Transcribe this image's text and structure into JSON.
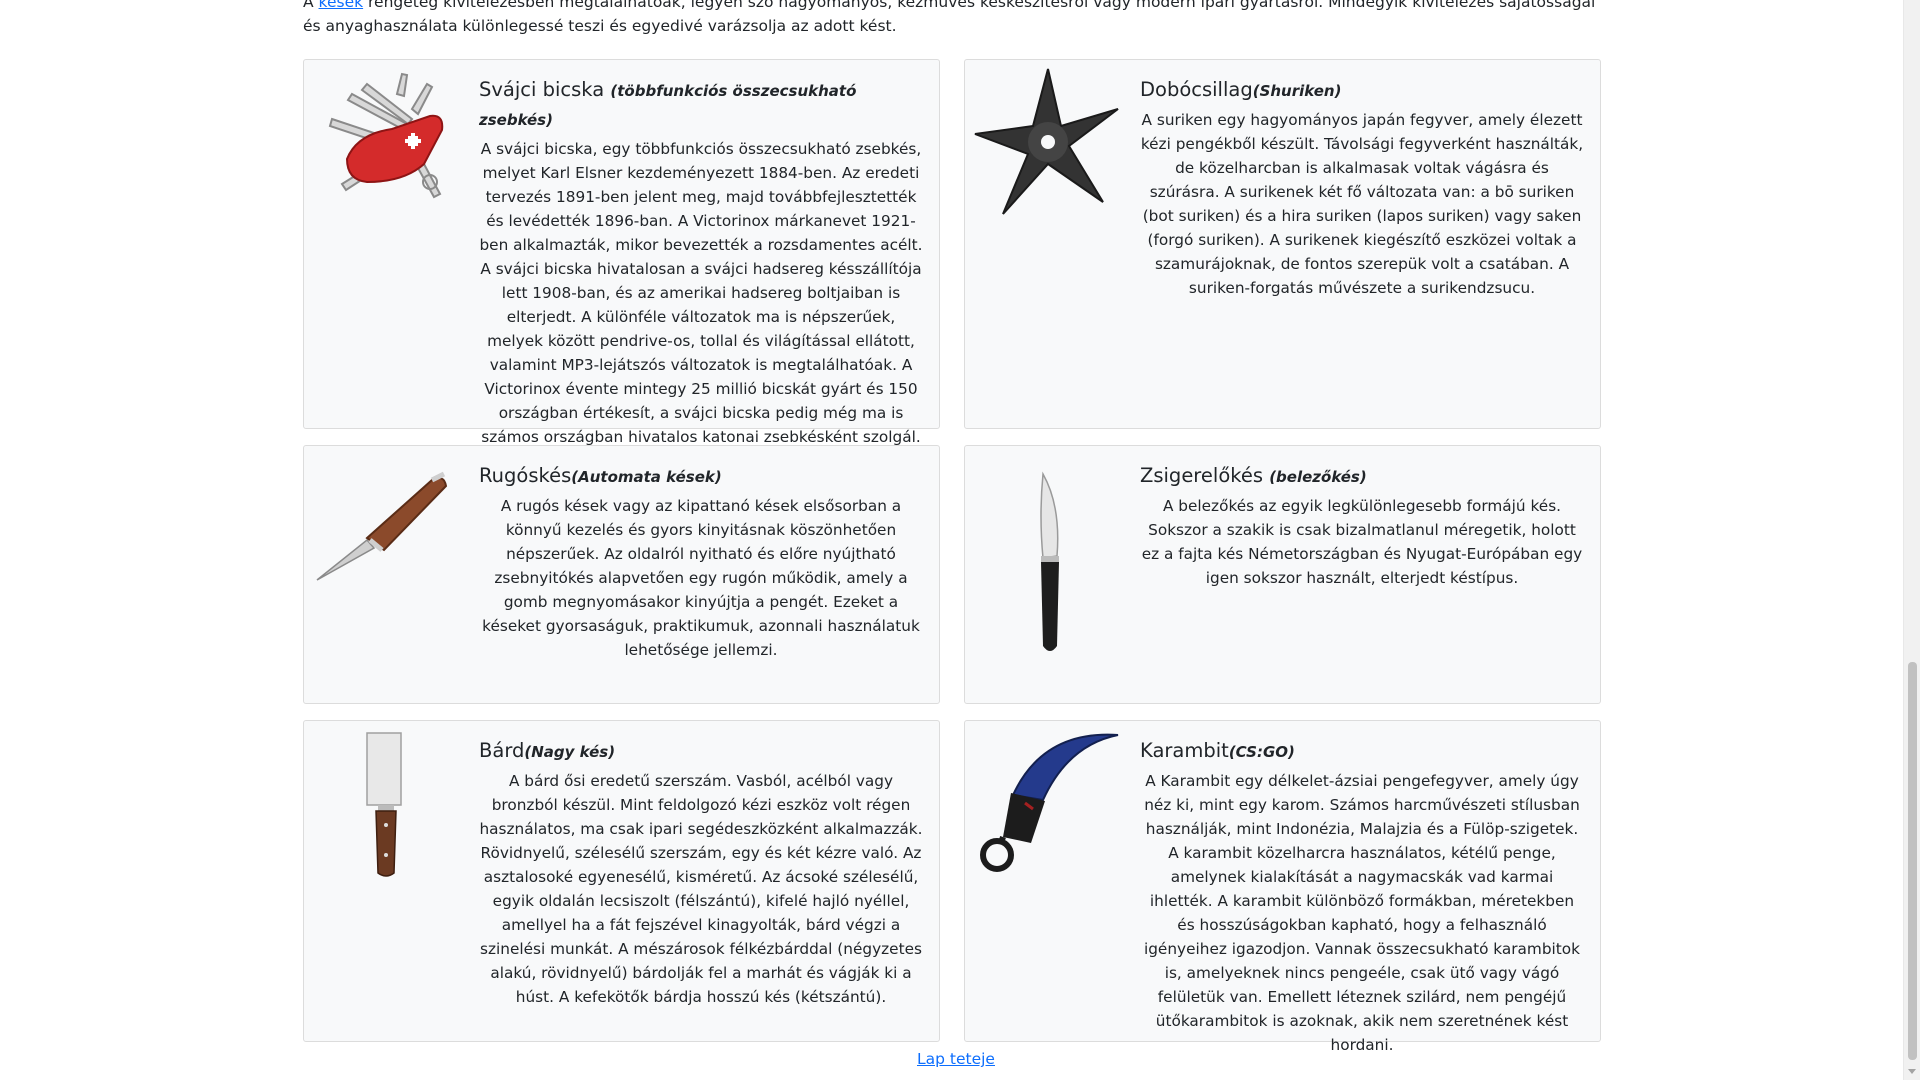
{
  "intro": {
    "link_text": "kések",
    "text_prefix": "A ",
    "text_suffix": " rengeteg kivitelezésben megtalálhatóak, legyen szó hagyományos, kézműves késkészítésről vagy modern ipari gyártásról. Mindegyik kivitelezés sajátosságai és anyaghasználata különlegessé teszi és egyedivé varázsolja az adott kést."
  },
  "cards": [
    {
      "title": "Svájci bicska ",
      "subtitle": "(többfunkciós összecsukható zsebkés)",
      "text": "A svájci bicska, egy többfunkciós összecsukható zsebkés, melyet Karl Elsner kezdeményezett 1884-ben. Az eredeti tervezés 1891-ben jelent meg, majd továbbfejlesztették és levédették 1896-ban. A Victorinox márkanevet 1921-ben alkalmazták, mikor bevezették a rozsdamentes acélt. A svájci bicska hivatalosan a svájci hadsereg késszállítója lett 1908-ban, és az amerikai hadsereg boltjaiban is elterjedt. A különféle változatok ma is népszerűek, melyek között pendrive-os, tollal és világítással ellátott, valamint MP3-lejátszós változatok is megtalálhatóak. A Victorinox évente mintegy 25 millió bicskát gyárt és 150 országban értékesít, a svájci bicska pedig még ma is számos országban hivatalos katonai zsebkésként szolgál.",
      "image_icon": "swiss-army-knife-icon"
    },
    {
      "title": "Dobócsillag",
      "subtitle": "(Shuriken)",
      "text": "A suriken egy hagyományos japán fegyver, amely élezett kézi pengékből készült. Távolsági fegyverként használták, de közelharcban is alkalmasak voltak vágásra és szúrásra. A surikenek két fő változata van: a bō suriken (bot suriken) és a hira suriken (lapos suriken) vagy saken (forgó suriken). A surikenek kiegészítő eszközei voltak a szamurájoknak, de fontos szerepük volt a csatában. A suriken-forgatás művészete a surikendzsucu.",
      "image_icon": "shuriken-icon"
    },
    {
      "title": "Rugóskés",
      "subtitle": "(Automata kések)",
      "text": "A rugós kések vagy az kipattanó kések elsősorban a könnyű kezelés és gyors kinyitásnak köszönhetően népszerűek. Az oldalról nyitható és előre nyújtható zsebnyitókés alapvetően egy rugón működik, amely a gomb megnyomásakor kinyújtja a pengét. Ezeket a késeket gyorsaságuk, praktikumuk, azonnali használatuk lehetősége jellemzi.",
      "image_icon": "switchblade-icon"
    },
    {
      "title": "Zsigerelőkés ",
      "subtitle": "(belezőkés)",
      "text": "A belezőkés az egyik legkülönlegesebb formájú kés. Sokszor a szakik is csak bizalmatlanul méregetik, holott ez a fajta kés Németországban és Nyugat-Európában egy igen sokszor használt, elterjedt késtípus.",
      "image_icon": "boning-knife-icon"
    },
    {
      "title": "Bárd",
      "subtitle": "(Nagy kés)",
      "text": "A bárd ősi eredetű szerszám. Vasból, acélból vagy bronzból készül. Mint feldolgozó kézi eszköz volt régen használatos, ma csak ipari segédeszközként alkalmazzák. Rövidnyelű, szélesélű szerszám, egy és két kézre való. Az asztalosoké egyenesélű, kisméretű. Az ácsoké szélesélű, egyik oldalán lecsiszolt (félszántú), kifelé hajló nyéllel, amellyel ha a fát fejszével kinagyolták, bárd végzi a szinelési munkát. A mészárosok félkézbárddal (négyzetes alakú, rövidnyelű) bárdolják fel a marhát és vágják ki a húst. A kefekötők bárdja hosszú kés (kétszántú).",
      "image_icon": "cleaver-icon"
    },
    {
      "title": "Karambit",
      "subtitle": "(CS:GO)",
      "text": "A Karambit egy délkelet-ázsiai pengefegyver, amely úgy néz ki, mint egy karom. Számos harcművészeti stílusban használják, mint Indonézia, Malajzia és a Fülöp-szigetek. A karambit közelharcra használatos, kétélű penge, amelynek kialakítását a nagymacskák vad karmai ihlették. A karambit különböző formákban, méretekben és hosszúságokban kapható, hogy a felhasználó igényeihez igazodjon. Vannak összecsukható karambitok is, amelyeknek nincs pengeéle, csak ütő vagy vágó felületük van. Emellett léteznek szilárd, nem pengéjű ütőkarambitok is azoknak, akik nem szeretnének kést hordani.",
      "image_icon": "karambit-icon"
    }
  ],
  "footer": {
    "top_link": "Lap teteje"
  },
  "colors": {
    "link": "#0d6efd",
    "card_bg": "#f8f9fa",
    "card_border": "#dcdcdc",
    "text": "#212529"
  }
}
